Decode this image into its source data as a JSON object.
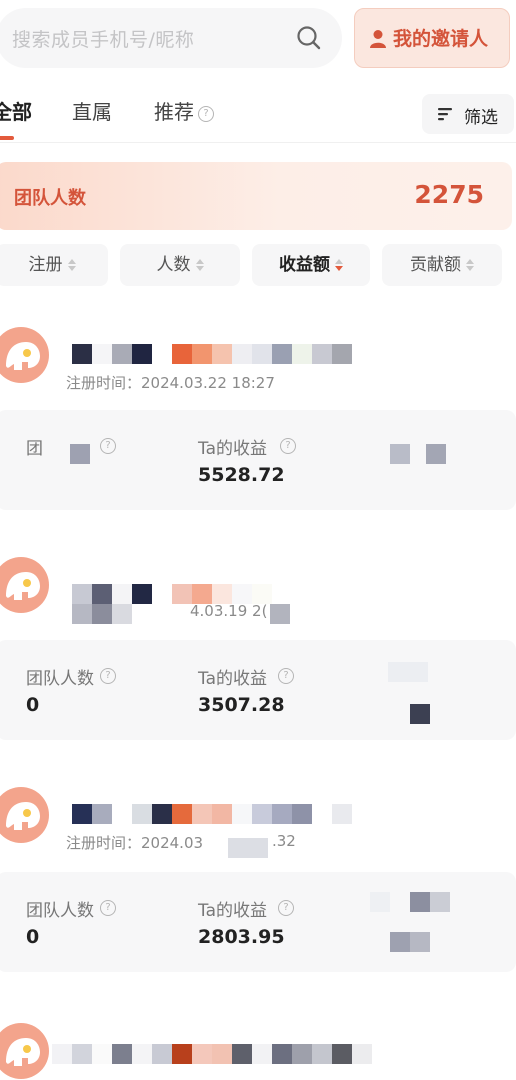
{
  "search": {
    "placeholder": "搜索成员手机号/昵称",
    "icon": "search-icon"
  },
  "inviter_button": {
    "label": "我的邀请人",
    "icon": "person-icon"
  },
  "tabs": [
    {
      "label": "全部",
      "active": true
    },
    {
      "label": "直属",
      "active": false
    },
    {
      "label": "推荐",
      "active": false,
      "help": "?"
    }
  ],
  "filter": {
    "label": "筛选",
    "icon": "filter-lines-icon"
  },
  "team_summary": {
    "label": "团队人数",
    "value": "2275"
  },
  "sort_buttons": [
    {
      "label": "注册",
      "active": false
    },
    {
      "label": "人数",
      "active": false
    },
    {
      "label": "收益额",
      "active": true,
      "direction": "desc"
    },
    {
      "label": "贡献额",
      "active": false
    }
  ],
  "members": [
    {
      "reg_text": "注册时间：2024.03.22 18:27",
      "team_label": "团",
      "team_value": "",
      "income_label": "Ta的收益",
      "income_value": "5528.72"
    },
    {
      "reg_text": "4.03.19 2(",
      "team_label": "团队人数",
      "team_value": "0",
      "income_label": "Ta的收益",
      "income_value": "3507.28"
    },
    {
      "reg_text": "注册时间：2024.03",
      "reg_tail": ".32",
      "team_label": "团队人数",
      "team_value": "0",
      "income_label": "Ta的收益",
      "income_value": "2803.95"
    }
  ],
  "colors": {
    "accent": "#e35a3c",
    "accent_bg": "#fbe7df",
    "card_bg": "#f7f7f8"
  }
}
